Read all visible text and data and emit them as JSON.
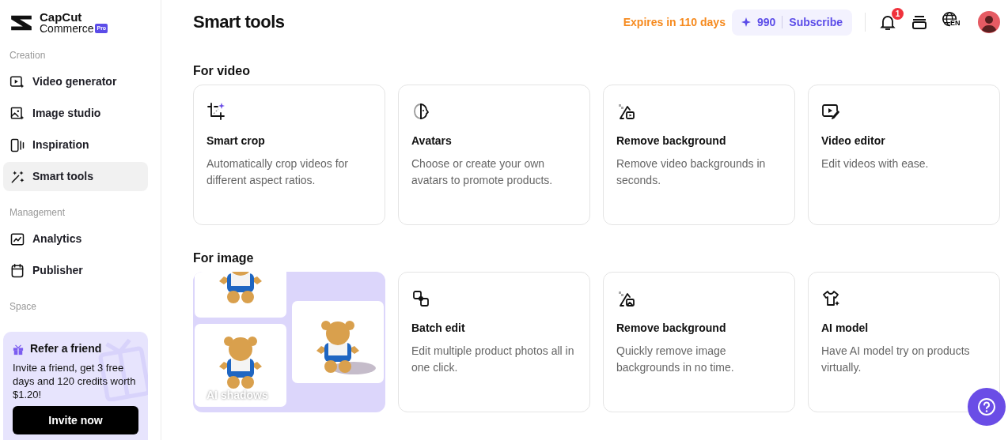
{
  "brand": {
    "name": "CapCut",
    "sub": "Commerce",
    "badge": "Pro"
  },
  "sidebar": {
    "sections": [
      {
        "title": "Creation",
        "items": [
          {
            "label": "Video generator",
            "selected": false
          },
          {
            "label": "Image studio",
            "selected": false
          },
          {
            "label": "Inspiration",
            "selected": false
          },
          {
            "label": "Smart tools",
            "selected": true
          }
        ]
      },
      {
        "title": "Management",
        "items": [
          {
            "label": "Analytics",
            "selected": false
          },
          {
            "label": "Publisher",
            "selected": false
          }
        ]
      },
      {
        "title": "Space"
      }
    ]
  },
  "referral": {
    "title": "Refer a friend",
    "text": "Invite a friend, get 3 free days and 120 credits worth $1.20!",
    "button": "Invite now"
  },
  "header": {
    "title": "Smart tools",
    "expiry": "Expires in 110 days",
    "credits": "990",
    "subscribe": "Subscribe",
    "notifications": "1",
    "language": "EN"
  },
  "sections": [
    {
      "title": "For video",
      "tools": [
        {
          "kind": "tool",
          "title": "Smart crop",
          "description": "Automatically crop videos for different aspect ratios."
        },
        {
          "kind": "tool",
          "title": "Avatars",
          "description": "Choose or create your own avatars to promote products."
        },
        {
          "kind": "tool",
          "title": "Remove background",
          "description": "Remove video backgrounds in seconds."
        },
        {
          "kind": "tool",
          "title": "Video editor",
          "description": "Edit videos with ease."
        }
      ]
    },
    {
      "title": "For image",
      "tools": [
        {
          "kind": "picture",
          "caption": "AI shadows"
        },
        {
          "kind": "tool",
          "title": "Batch edit",
          "description": "Edit multiple product photos all in one click."
        },
        {
          "kind": "tool",
          "title": "Remove background",
          "description": "Quickly remove image backgrounds in no time."
        },
        {
          "kind": "tool",
          "title": "AI model",
          "description": "Have AI model try on products virtually."
        }
      ]
    }
  ]
}
